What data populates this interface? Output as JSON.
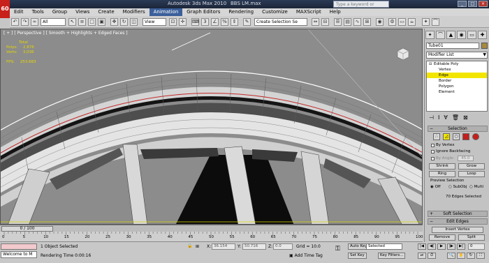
{
  "title": {
    "app": "Autodesk 3ds Max  2010",
    "file": "BBS LM.max",
    "help_placeholder": "Type a keyword or phrase",
    "logo": "60"
  },
  "menu": [
    "Edit",
    "Tools",
    "Group",
    "Views",
    "Create",
    "Modifiers",
    "Animation",
    "Graph Editors",
    "Rendering",
    "Customize",
    "MAXScript",
    "Help"
  ],
  "menu_active": "Animation",
  "toolbar": {
    "filter": "All",
    "ref_coord": "View",
    "named_sel": "Create Selection Se"
  },
  "viewport": {
    "label": "[ + ] [ Perspective ] [ Smooth + Highlights + Edged Faces ]",
    "stats": {
      "total_label": "Total",
      "polys_label": "Polys:",
      "polys": "2,876",
      "verts_label": "Verts:",
      "verts": "3,036",
      "fps_label": "FPS:",
      "fps": "253.683"
    }
  },
  "command_panel": {
    "object_name": "Tube01",
    "modifier_list": "Modifier List",
    "stack": [
      {
        "label": "Editable Poly",
        "level": "root"
      },
      {
        "label": "Vertex",
        "level": "sub"
      },
      {
        "label": "Edge",
        "level": "sub",
        "selected": true
      },
      {
        "label": "Border",
        "level": "sub"
      },
      {
        "label": "Polygon",
        "level": "sub"
      },
      {
        "label": "Element",
        "level": "sub"
      }
    ],
    "selection": {
      "title": "Selection",
      "by_vertex": "By Vertex",
      "ignore_backfacing": "Ignore Backfacing",
      "by_angle": "By Angle:",
      "angle": "45.0",
      "shrink": "Shrink",
      "grow": "Grow",
      "ring": "Ring",
      "loop": "Loop",
      "preview": "Preview Selection",
      "off": "Off",
      "subobj": "SubObj",
      "multi": "Multi",
      "status": "70 Edges Selected"
    },
    "soft_selection": "Soft Selection",
    "edit_edges": "Edit Edges",
    "insert_vertex": "Insert Vertex",
    "remove": "Remove",
    "split": "Split"
  },
  "timeline": {
    "slider": "0 / 100",
    "ticks": [
      "0",
      "5",
      "10",
      "15",
      "20",
      "25",
      "30",
      "35",
      "40",
      "45",
      "50",
      "55",
      "60",
      "65",
      "70",
      "75",
      "80",
      "85",
      "90",
      "95",
      "100"
    ]
  },
  "status": {
    "welcome": "Welcome to M",
    "selected": "1 Object Selected",
    "render_time": "Rendering Time  0:00:16",
    "x_label": "X:",
    "x": "36.154",
    "y_label": "Y:",
    "y": "50.716",
    "z_label": "Z:",
    "z": "0.0",
    "grid": "Grid = 10.0",
    "add_time_tag": "Add Time Tag",
    "auto_key": "Auto Key",
    "auto_key_mode": "Selected",
    "set_key": "Set Key",
    "key_filters": "Key Filters...",
    "frame": "0"
  }
}
